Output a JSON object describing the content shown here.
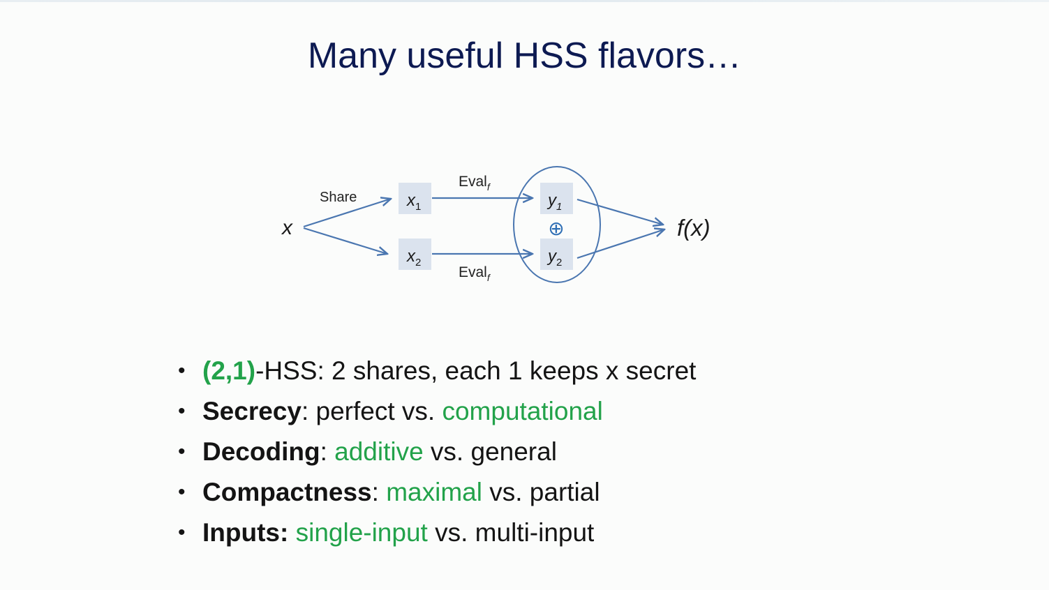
{
  "title": "Many useful HSS flavors…",
  "diagram": {
    "input": "x",
    "share_label": "Share",
    "share1": {
      "base": "x",
      "sub": "1"
    },
    "share2": {
      "base": "x",
      "sub": "2"
    },
    "eval_top": {
      "base": "Eval",
      "sub": "f"
    },
    "eval_bottom": {
      "base": "Eval",
      "sub": "f"
    },
    "out1": {
      "base": "y",
      "sub": "1"
    },
    "out2": {
      "base": "y",
      "sub": "2"
    },
    "combine_symbol": "⊕",
    "output": "f(x)"
  },
  "bullet_marker": "•",
  "bullets": [
    {
      "a": "(2,1)",
      "b": "-HSS: 2 shares, each 1 keeps x secret"
    },
    {
      "a": "Secrecy",
      "b": ": perfect vs. ",
      "c": "computational"
    },
    {
      "a": "Decoding",
      "b": ": ",
      "c": "additive",
      "d": " vs. general"
    },
    {
      "a": "Compactness",
      "b": ": ",
      "c": "maximal",
      "d": " vs. partial"
    },
    {
      "a": "Inputs: ",
      "c": "single-input",
      "d": " vs. multi-input"
    }
  ],
  "colors": {
    "title": "#0d1a52",
    "highlight": "#22a24a",
    "arrow": "#4a76b0",
    "box": "#dbe3ee"
  }
}
